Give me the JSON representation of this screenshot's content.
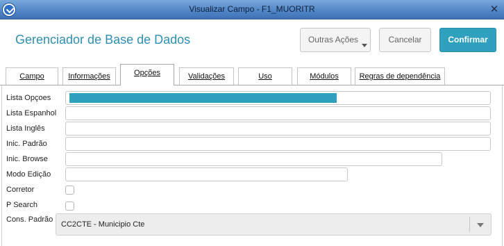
{
  "window": {
    "title": "Visualizar Campo - F1_MUORITR",
    "close_glyph": "✕"
  },
  "header": {
    "title": "Gerenciador de Base de Dados",
    "buttons": {
      "outras_acoes": "Outras Ações",
      "cancelar": "Cancelar",
      "confirmar": "Confirmar"
    }
  },
  "tabs": [
    {
      "label": "Campo",
      "active": false
    },
    {
      "label": "Informações",
      "active": false
    },
    {
      "label": "Opções",
      "active": true
    },
    {
      "label": "Validações",
      "active": false
    },
    {
      "label": "Uso",
      "active": false
    },
    {
      "label": "Módulos",
      "active": false
    },
    {
      "label": "Regras de dependência",
      "active": false
    }
  ],
  "form": {
    "lista_opcoes": {
      "label": "Lista Opçoes",
      "value": "",
      "highlight_fill_fraction": 0.64
    },
    "lista_espanhol": {
      "label": "Lista Espanhol",
      "value": ""
    },
    "lista_ingles": {
      "label": "Lista Inglês",
      "value": ""
    },
    "inic_padrao": {
      "label": "Inic. Padrão",
      "value": ""
    },
    "inic_browse": {
      "label": "Inic. Browse",
      "value": ""
    },
    "modo_edicao": {
      "label": "Modo Edição",
      "value": ""
    },
    "corretor": {
      "label": "Corretor",
      "checked": false
    },
    "p_search": {
      "label": "P Search",
      "checked": false
    },
    "cons_padrao": {
      "label": "Cons. Padrão",
      "selected": "CC2CTE - Municipio Cte"
    }
  },
  "colors": {
    "accent": "#2fa1bf",
    "title_text": "#2f8fb2",
    "titlebar": "#4f84c6"
  }
}
